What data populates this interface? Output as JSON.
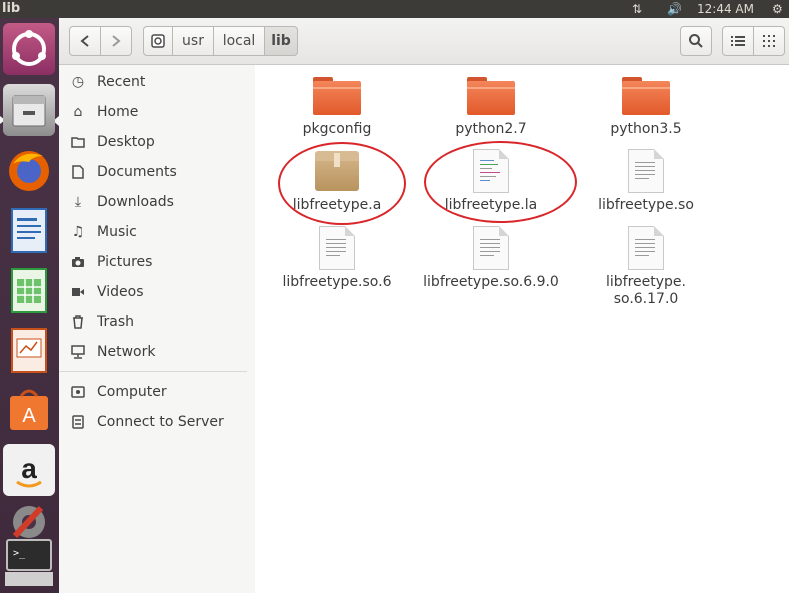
{
  "window": {
    "title": "lib"
  },
  "panel": {
    "clock": "12:44 AM",
    "icons": [
      "network-arrows-icon",
      "volume-icon",
      "settings-gear-icon"
    ]
  },
  "launcher": {
    "apps": [
      "ubuntu-dash-icon",
      "files-icon",
      "firefox-icon",
      "writer-icon",
      "calc-icon",
      "impress-icon",
      "software-center-icon",
      "amazon-icon",
      "system-settings-icon",
      "terminal-icon"
    ]
  },
  "breadcrumbs": [
    "usr",
    "local",
    "lib"
  ],
  "sidebar": {
    "places": [
      {
        "label": "Recent",
        "icon": "clock-icon"
      },
      {
        "label": "Home",
        "icon": "home-icon"
      },
      {
        "label": "Desktop",
        "icon": "folder-icon"
      },
      {
        "label": "Documents",
        "icon": "document-icon"
      },
      {
        "label": "Downloads",
        "icon": "download-icon"
      },
      {
        "label": "Music",
        "icon": "music-icon"
      },
      {
        "label": "Pictures",
        "icon": "camera-icon"
      },
      {
        "label": "Videos",
        "icon": "video-icon"
      },
      {
        "label": "Trash",
        "icon": "trash-icon"
      },
      {
        "label": "Network",
        "icon": "network-icon"
      }
    ],
    "devices": [
      {
        "label": "Computer",
        "icon": "computer-icon"
      },
      {
        "label": "Connect to Server",
        "icon": "server-icon"
      }
    ]
  },
  "files": [
    {
      "name": "pkgconfig",
      "type": "folder"
    },
    {
      "name": "python2.7",
      "type": "folder"
    },
    {
      "name": "python3.5",
      "type": "folder"
    },
    {
      "name": "libfreetype.a",
      "type": "archive",
      "highlighted": true
    },
    {
      "name": "libfreetype.la",
      "type": "text",
      "highlighted": true
    },
    {
      "name": "libfreetype.so",
      "type": "document"
    },
    {
      "name": "libfreetype.so.6",
      "type": "document"
    },
    {
      "name": "libfreetype.so.6.9.0",
      "type": "document"
    },
    {
      "name": "libfreetype.\nso.6.17.0",
      "type": "document"
    }
  ],
  "colors": {
    "highlight_circle": "#d9262a",
    "folder": "#e8682f",
    "panel": "#3c3b37",
    "launcher": "#4a3346"
  }
}
